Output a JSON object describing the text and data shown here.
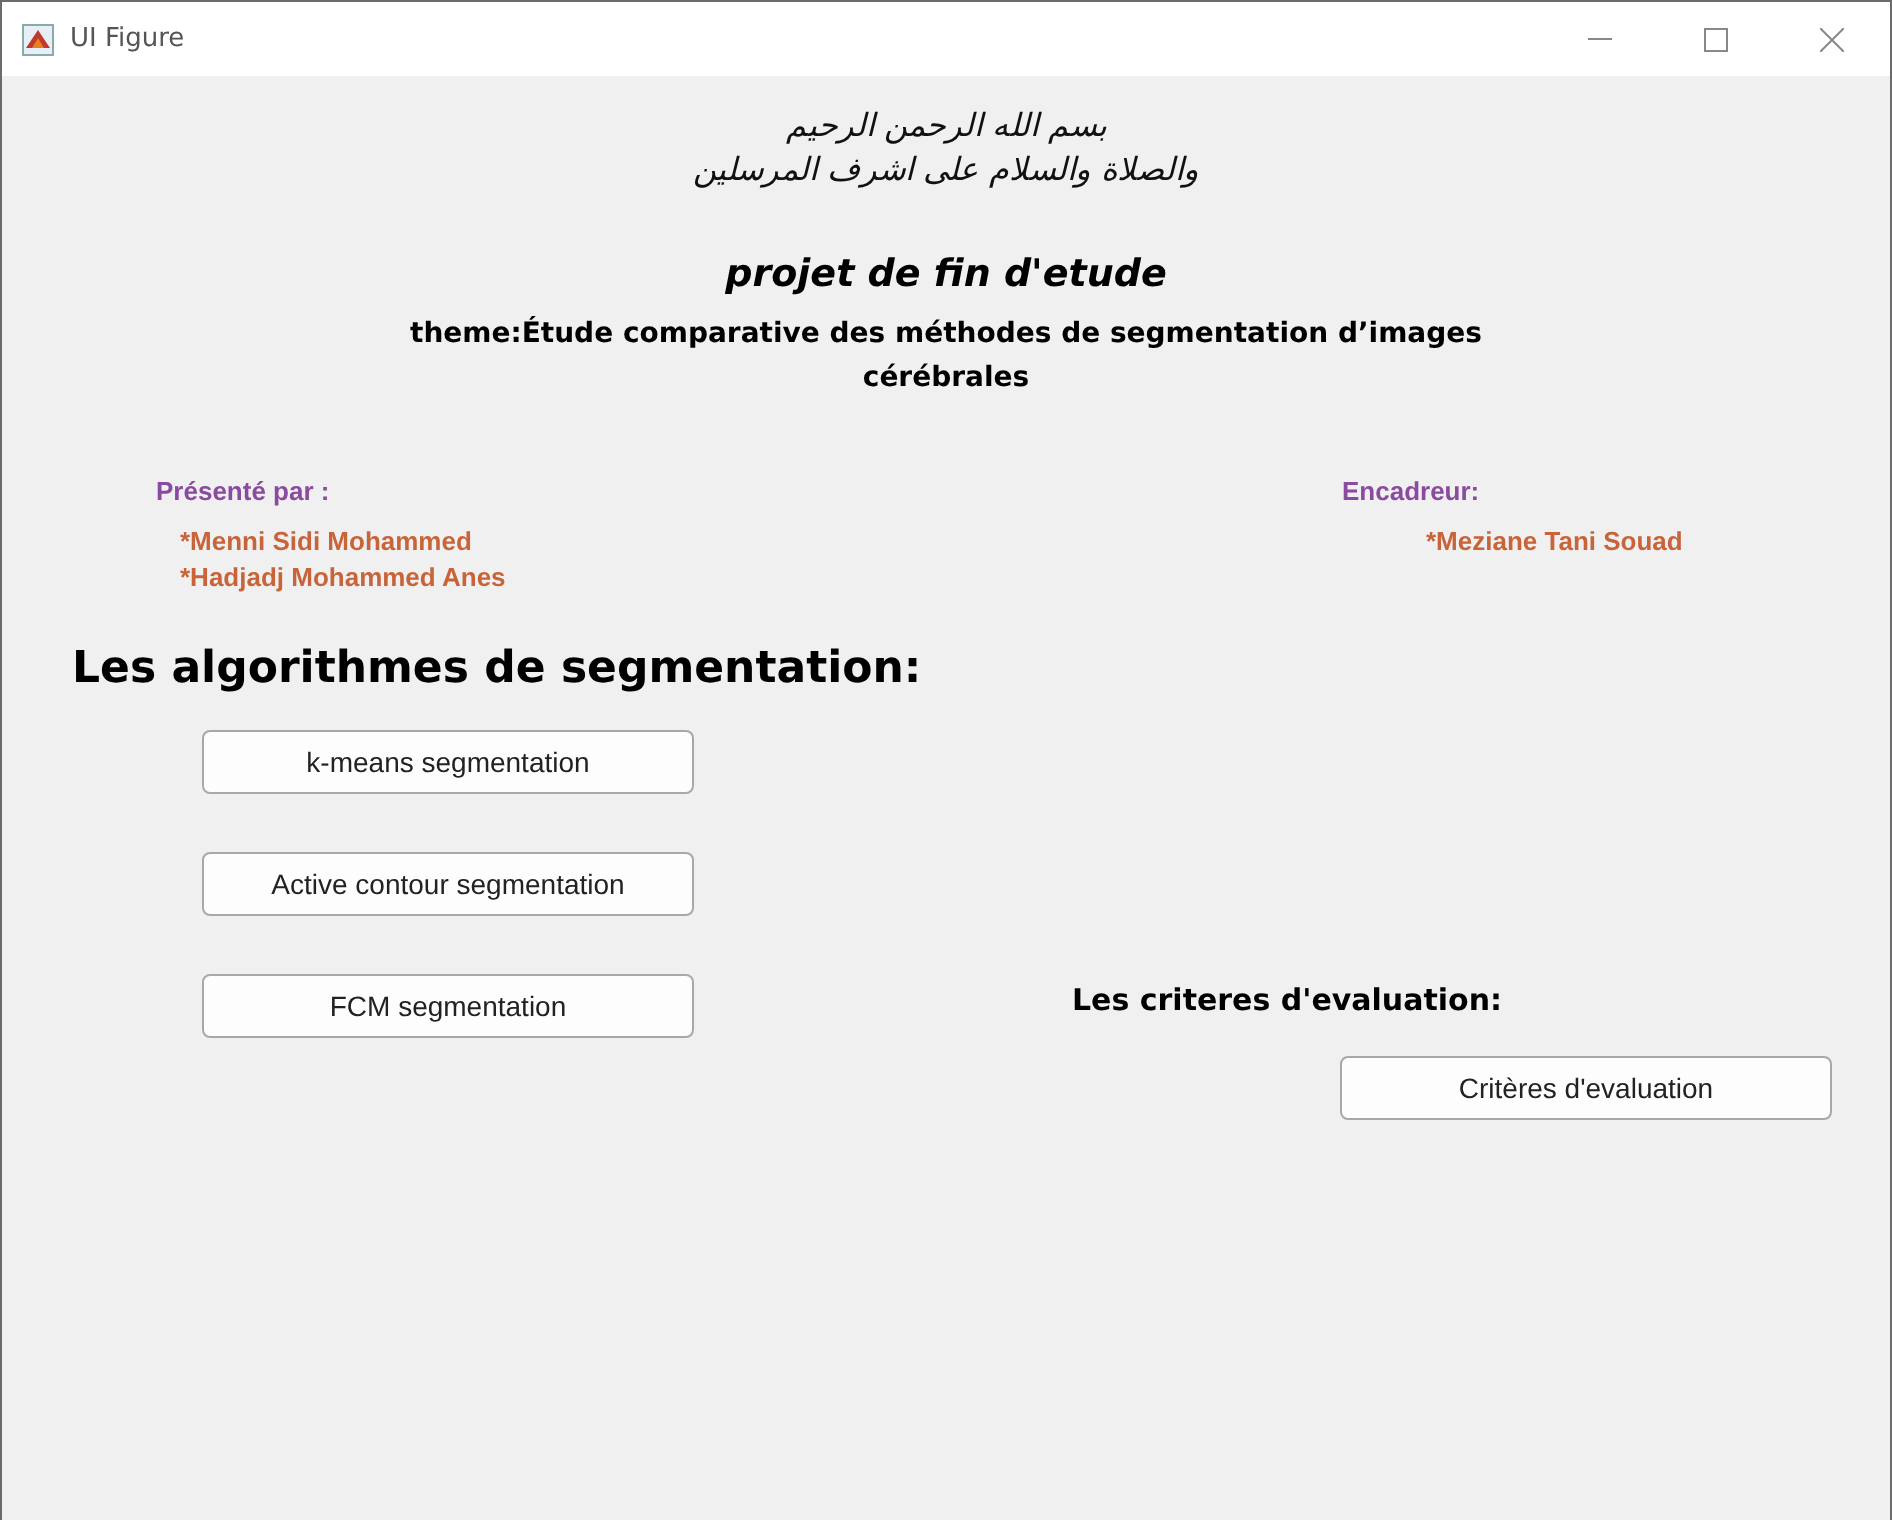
{
  "window": {
    "title": "UI Figure"
  },
  "header": {
    "basmala": [
      "بسم الله الرحمن الرحيم",
      "والصلاة والسلام على اشرف المرسلين"
    ],
    "title": "projet de fin d'etude",
    "theme": [
      "theme:Étude comparative des méthodes de segmentation d’images",
      "cérébrales"
    ]
  },
  "presenters": {
    "label": "Présenté par :",
    "names": [
      "*Menni Sidi Mohammed",
      "*Hadjadj Mohammed Anes"
    ]
  },
  "supervisor": {
    "label": "Encadreur:",
    "names": [
      "*Meziane Tani Souad"
    ]
  },
  "algorithms": {
    "heading": "Les algorithmes de segmentation:",
    "buttons": [
      "k-means segmentation",
      "Active contour segmentation",
      "FCM segmentation"
    ]
  },
  "evaluation": {
    "heading": "Les criteres d'evaluation:",
    "button": "Critères d'evaluation"
  }
}
